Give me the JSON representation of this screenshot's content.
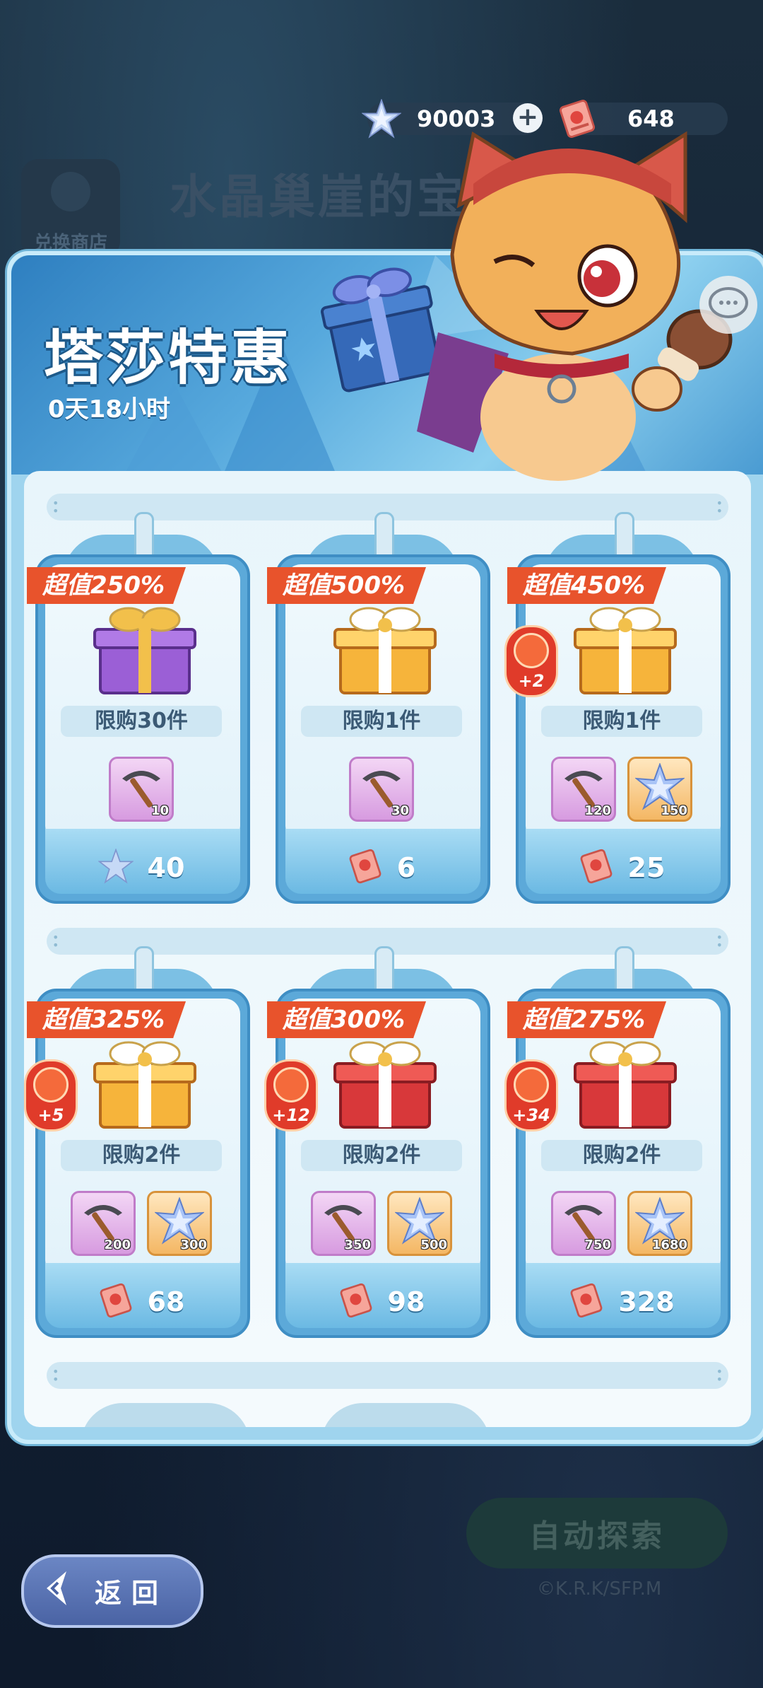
{
  "background": {
    "title": "水晶巢崖的宝藏",
    "shop_label": "兑换商店",
    "auto_explore": "自动探索",
    "copyright": "©K.R.K/SFP.M"
  },
  "resources": {
    "gems": "90003",
    "tickets": "648"
  },
  "panel": {
    "title": "塔莎特惠",
    "countdown": "0天18小时"
  },
  "cards": [
    {
      "tag": "超值250%",
      "limit": "限购30件",
      "gift": "purple",
      "badge": null,
      "items": [
        {
          "type": "pickaxe",
          "qty": "10"
        }
      ],
      "price_currency": "gem",
      "price": "40"
    },
    {
      "tag": "超值500%",
      "limit": "限购1件",
      "gift": "gold",
      "badge": null,
      "items": [
        {
          "type": "pickaxe",
          "qty": "30"
        }
      ],
      "price_currency": "ticket",
      "price": "6"
    },
    {
      "tag": "超值450%",
      "limit": "限购1件",
      "gift": "gold",
      "badge": "+2",
      "items": [
        {
          "type": "pickaxe",
          "qty": "120"
        },
        {
          "type": "crystal",
          "qty": "150"
        }
      ],
      "price_currency": "ticket",
      "price": "25"
    },
    {
      "tag": "超值325%",
      "limit": "限购2件",
      "gift": "gold",
      "badge": "+5",
      "items": [
        {
          "type": "pickaxe",
          "qty": "200"
        },
        {
          "type": "crystal",
          "qty": "300"
        }
      ],
      "price_currency": "ticket",
      "price": "68"
    },
    {
      "tag": "超值300%",
      "limit": "限购2件",
      "gift": "red",
      "badge": "+12",
      "items": [
        {
          "type": "pickaxe",
          "qty": "350"
        },
        {
          "type": "crystal",
          "qty": "500"
        }
      ],
      "price_currency": "ticket",
      "price": "98"
    },
    {
      "tag": "超值275%",
      "limit": "限购2件",
      "gift": "red",
      "badge": "+34",
      "items": [
        {
          "type": "pickaxe",
          "qty": "750"
        },
        {
          "type": "crystal",
          "qty": "1680"
        }
      ],
      "price_currency": "ticket",
      "price": "328"
    }
  ],
  "back_button": "返回",
  "colors": {
    "tag_red": "#e8532c",
    "panel_blue": "#9fd4ee",
    "card_blue": "#5ca9d9"
  }
}
